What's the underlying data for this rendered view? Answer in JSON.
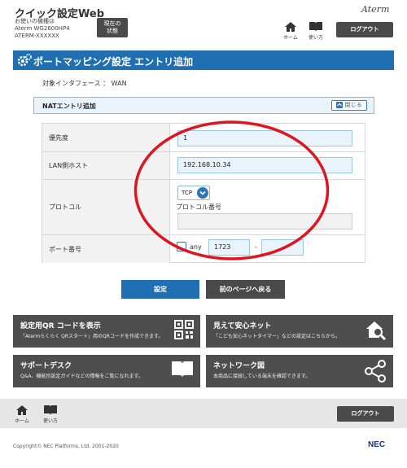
{
  "header": {
    "app_title": "クイック設定Web",
    "device_label": "お使いの機種は",
    "device_model": "Aterm WG2600HP4",
    "device_id": "ATERM-XXXXXX",
    "status_button": [
      "現在の",
      "状態"
    ],
    "brand": "Aterm",
    "home_label": "ホーム",
    "manual_label": "使い方",
    "logout_label": "ログアウト"
  },
  "page": {
    "title": "ポートマッピング設定 エントリ追加",
    "interface_text": "対象インタフェース ： WAN"
  },
  "nat_panel": {
    "heading": "NATエントリ追加",
    "close_label": "閉じる"
  },
  "form": {
    "priority_label": "優先度",
    "priority_value": "1",
    "lan_host_label": "LAN側ホスト",
    "lan_host_value": "192.168.10.34",
    "protocol_label": "プロトコル",
    "protocol_value": "TCP",
    "protocol_number_label": "プロトコル番号",
    "protocol_number_value": "",
    "port_label": "ポート番号",
    "port_any_label": "any",
    "port_any_checked": false,
    "port_from": "1723",
    "port_separator": "-",
    "port_to": ""
  },
  "actions": {
    "set_label": "設定",
    "back_label": "前のページへ戻る"
  },
  "cards": [
    {
      "title": "設定用QR コードを表示",
      "desc": "「Atermらくらく QRスタート」用のQRコードを作成できます。",
      "icon": "qr-code-icon"
    },
    {
      "title": "見えて安心ネット",
      "desc": "「こども安心ネットタイマー」などの設定はこちらから。",
      "icon": "house-search-icon"
    },
    {
      "title": "サポートデスク",
      "desc": "Q&A、機能別設定ガイドなどの情報をご覧になれます。",
      "icon": "book-icon"
    },
    {
      "title": "ネットワーク図",
      "desc": "本商品に接続している端末を確認できます。",
      "icon": "network-share-icon"
    }
  ],
  "footer": {
    "home_label": "ホーム",
    "manual_label": "使い方",
    "logout_label": "ログアウト",
    "copyright": "Copyright© NEC Platforms, Ltd. 2001-2020",
    "logo": "NEC"
  },
  "colors": {
    "accent_blue": "#1f6fb2",
    "dark_button": "#4a4a4a",
    "annotation_red": "#e0141e"
  }
}
